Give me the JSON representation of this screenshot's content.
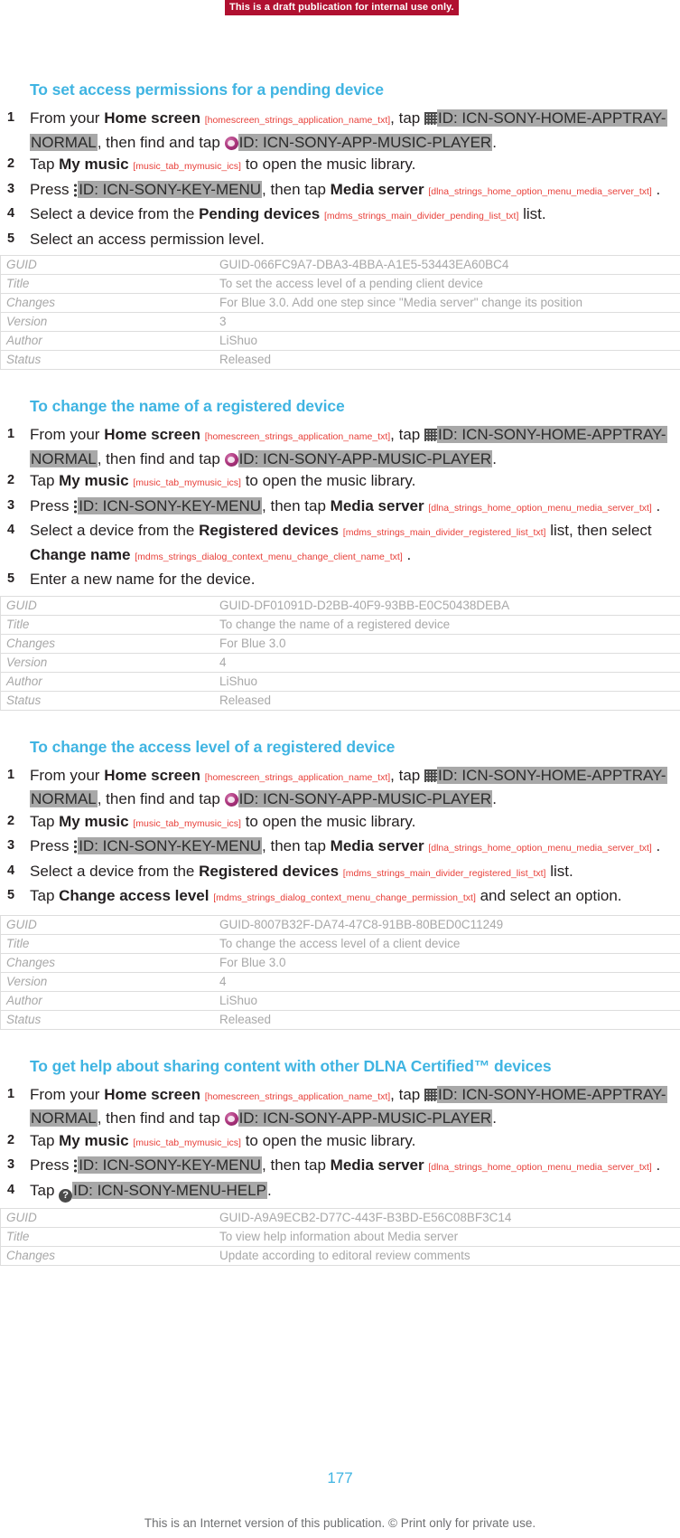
{
  "banner": {
    "text": "This is a draft publication for internal use only."
  },
  "colors": {
    "banner_bg": "#b01030",
    "heading": "#3fb4e2",
    "string_id": "#e8403a",
    "id_tag_bg": "#a8a8a8",
    "table_text": "#a8a8a8"
  },
  "common": {
    "step1": {
      "prefix": "From your ",
      "ui1": "Home screen",
      "strid1": "[homescreen_strings_application_name_txt]",
      "mid1": ", tap ",
      "icon1": "apptray-icon",
      "idtag1": "ID: ICN-SONY-HOME-APPTRAY-NORMAL",
      "mid2": ", then find and tap ",
      "icon2": "music-player-icon",
      "idtag2": "ID: ICN-SONY-APP-MUSIC-PLAYER",
      "suffix": "."
    },
    "step2": {
      "prefix": "Tap ",
      "ui1": "My music",
      "strid1": "[music_tab_mymusic_ics]",
      "suffix": " to open the music library."
    },
    "step3": {
      "prefix": "Press ",
      "icon1": "menu-icon",
      "idtag1": "ID: ICN-SONY-KEY-MENU",
      "mid1": ", then tap ",
      "ui1": "Media server",
      "strid1": "[dlna_strings_home_option_menu_media_server_txt]",
      "suffix": " ."
    }
  },
  "sections": [
    {
      "title": "To set access permissions for a pending device",
      "steps": [
        {
          "n": "1",
          "type": "step1"
        },
        {
          "n": "2",
          "type": "step2"
        },
        {
          "n": "3",
          "type": "step3"
        },
        {
          "n": "4",
          "type": "plain",
          "prefix": "Select a device from the ",
          "ui1": "Pending devices",
          "strid1": "[mdms_strings_main_divider_pending_list_txt]",
          "suffix": " list."
        },
        {
          "n": "5",
          "type": "plain",
          "prefix": "Select an access permission level.",
          "ui1": "",
          "strid1": "",
          "suffix": ""
        }
      ],
      "meta": {
        "labels": [
          "GUID",
          "Title",
          "Changes",
          "Version",
          "Author",
          "Status"
        ],
        "values": [
          "GUID-066FC9A7-DBA3-4BBA-A1E5-53443EA60BC4",
          "To set the access level of a pending client device",
          "For Blue 3.0. Add one step since \"Media server\" change its position",
          "3",
          "LiShuo",
          "Released"
        ]
      }
    },
    {
      "title": "To change the name of a registered device",
      "steps": [
        {
          "n": "1",
          "type": "step1"
        },
        {
          "n": "2",
          "type": "step2"
        },
        {
          "n": "3",
          "type": "step3"
        },
        {
          "n": "4",
          "type": "plain2",
          "prefix": "Select a device from the ",
          "ui1": "Registered devices",
          "strid1": "[mdms_strings_main_divider_registered_list_txt]",
          "mid1": " list, then select ",
          "ui2": "Change name",
          "strid2": "[mdms_strings_dialog_context_menu_change_client_name_txt]",
          "suffix": " ."
        },
        {
          "n": "5",
          "type": "plain",
          "prefix": "Enter a new name for the device.",
          "ui1": "",
          "strid1": "",
          "suffix": ""
        }
      ],
      "meta": {
        "labels": [
          "GUID",
          "Title",
          "Changes",
          "Version",
          "Author",
          "Status"
        ],
        "values": [
          "GUID-DF01091D-D2BB-40F9-93BB-E0C50438DEBA",
          "To change the name of a registered device",
          "For Blue 3.0",
          "4",
          "LiShuo",
          "Released"
        ]
      }
    },
    {
      "title": "To change the access level of a registered device",
      "steps": [
        {
          "n": "1",
          "type": "step1"
        },
        {
          "n": "2",
          "type": "step2"
        },
        {
          "n": "3",
          "type": "step3"
        },
        {
          "n": "4",
          "type": "plain",
          "prefix": "Select a device from the ",
          "ui1": "Registered devices",
          "strid1": "[mdms_strings_main_divider_registered_list_txt]",
          "suffix": " list."
        },
        {
          "n": "5",
          "type": "plain",
          "prefix": "Tap ",
          "ui1": "Change access level",
          "strid1": "[mdms_strings_dialog_context_menu_change_permission_txt]",
          "suffix": " and select an option."
        }
      ],
      "meta": {
        "labels": [
          "GUID",
          "Title",
          "Changes",
          "Version",
          "Author",
          "Status"
        ],
        "values": [
          "GUID-8007B32F-DA74-47C8-91BB-80BED0C11249",
          "To change the access level of a client device",
          "For Blue 3.0",
          "4",
          "LiShuo",
          "Released"
        ]
      }
    },
    {
      "title": "To get help about sharing content with other DLNA Certified™ devices",
      "steps": [
        {
          "n": "1",
          "type": "step1"
        },
        {
          "n": "2",
          "type": "step2"
        },
        {
          "n": "3",
          "type": "step3"
        },
        {
          "n": "4",
          "type": "iconstep",
          "prefix": "Tap ",
          "icon1": "help-icon",
          "idtag1": "ID: ICN-SONY-MENU-HELP",
          "suffix": "."
        }
      ],
      "meta": {
        "labels": [
          "GUID",
          "Title",
          "Changes"
        ],
        "values": [
          "GUID-A9A9ECB2-D77C-443F-B3BD-E56C08BF3C14",
          "To view help information about Media server",
          "Update according to editoral review comments"
        ]
      }
    }
  ],
  "footer": {
    "page_number": "177",
    "note": "This is an Internet version of this publication. © Print only for private use."
  }
}
